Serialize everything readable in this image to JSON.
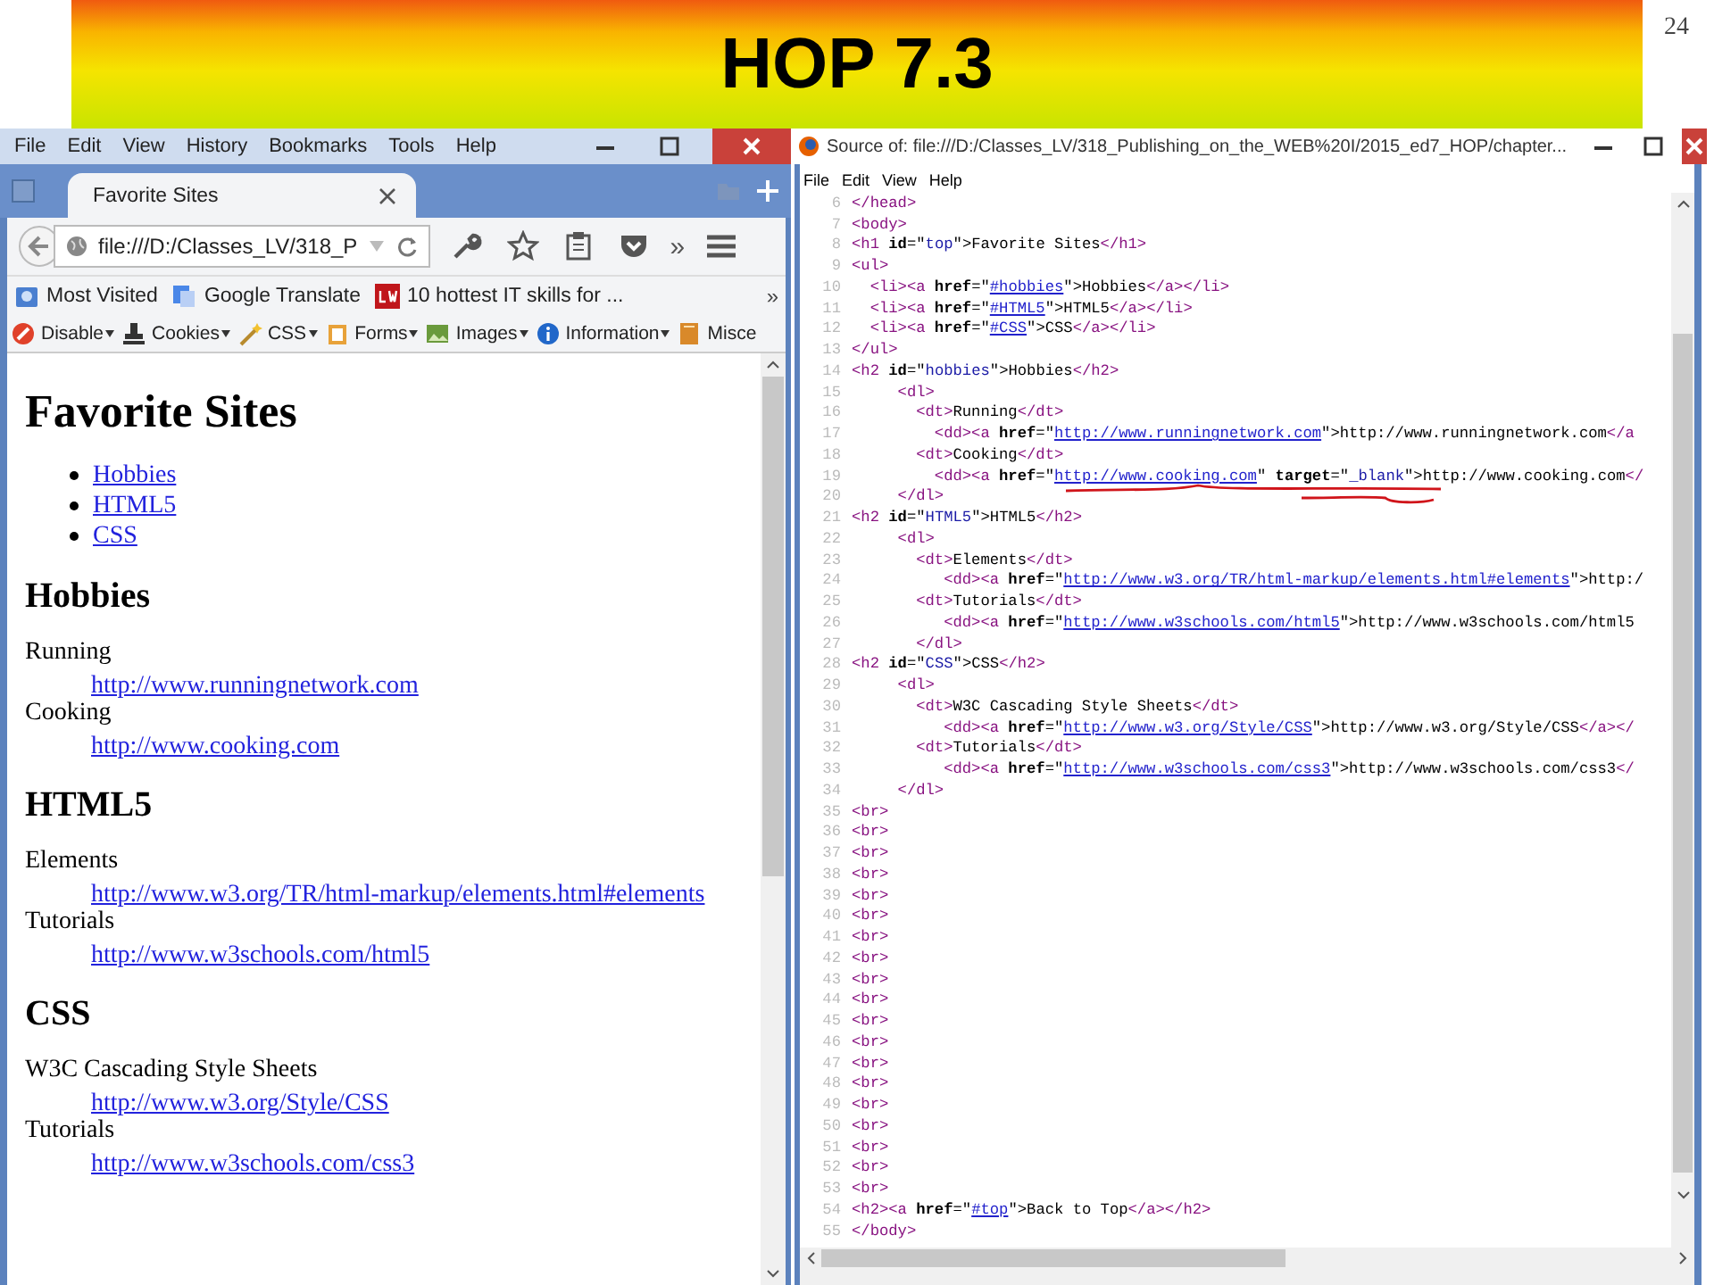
{
  "slide": {
    "title": "HOP 7.3",
    "page_number": "24"
  },
  "browser": {
    "menu": [
      "File",
      "Edit",
      "View",
      "History",
      "Bookmarks",
      "Tools",
      "Help"
    ],
    "tabs": [
      {
        "label": "Favorite Sites",
        "selected": true
      }
    ],
    "address": "file:///D:/Classes_LV/318_P",
    "overflow_chevron": "»",
    "bookmarks": [
      {
        "label": "Most Visited",
        "kind": "folder"
      },
      {
        "label": "Google Translate",
        "kind": "translate"
      },
      {
        "label": "10 hottest IT skills for ...",
        "kind": "cw"
      }
    ],
    "bookmarks_chevron": "»",
    "dev_toolbar": [
      {
        "label": "Disable",
        "kind": "disable"
      },
      {
        "label": "Cookies",
        "kind": "cookies"
      },
      {
        "label": "CSS",
        "kind": "css"
      },
      {
        "label": "Forms",
        "kind": "forms"
      },
      {
        "label": "Images",
        "kind": "images"
      },
      {
        "label": "Information",
        "kind": "info"
      },
      {
        "label": "Misce",
        "kind": "misc"
      }
    ],
    "page": {
      "heading": "Favorite Sites",
      "toc": [
        "Hobbies",
        "HTML5",
        "CSS"
      ],
      "sections": [
        {
          "heading": "Hobbies",
          "entries": [
            {
              "term": "Running",
              "link": "http://www.runningnetwork.com"
            },
            {
              "term": "Cooking",
              "link": "http://www.cooking.com"
            }
          ]
        },
        {
          "heading": "HTML5",
          "entries": [
            {
              "term": "Elements",
              "link": "http://www.w3.org/TR/html-markup/elements.html#elements"
            },
            {
              "term": "Tutorials",
              "link": "http://www.w3schools.com/html5"
            }
          ]
        },
        {
          "heading": "CSS",
          "entries": [
            {
              "term": "W3C Cascading Style Sheets",
              "link": "http://www.w3.org/Style/CSS"
            },
            {
              "term": "Tutorials",
              "link": "http://www.w3schools.com/css3"
            }
          ]
        }
      ]
    }
  },
  "source_window": {
    "title": "Source of: file:///D:/Classes_LV/318_Publishing_on_the_WEB%20I/2015_ed7_HOP/chapter...",
    "menu": [
      "File",
      "Edit",
      "View",
      "Help"
    ],
    "lines": [
      {
        "number": "6",
        "tokens": [
          {
            "kind": "tag",
            "text": "</head>"
          }
        ]
      },
      {
        "number": "7",
        "tokens": [
          {
            "kind": "tag",
            "text": "<body>"
          }
        ]
      },
      {
        "number": "8",
        "tokens": [
          {
            "kind": "tag",
            "text": "<h1"
          },
          {
            "kind": "attr",
            "text": " id"
          },
          {
            "kind": "text",
            "text": "=\""
          },
          {
            "kind": "value",
            "text": "top"
          },
          {
            "kind": "text",
            "text": "\">Favorite Sites"
          },
          {
            "kind": "tag",
            "text": "</h1>"
          }
        ]
      },
      {
        "number": "9",
        "tokens": [
          {
            "kind": "tag",
            "text": "<ul>"
          }
        ]
      },
      {
        "number": "10",
        "tokens": [
          {
            "kind": "tag",
            "text": "  <li><a"
          },
          {
            "kind": "attr",
            "text": " href"
          },
          {
            "kind": "text",
            "text": "=\""
          },
          {
            "kind": "link",
            "text": "#hobbies"
          },
          {
            "kind": "text",
            "text": "\">Hobbies"
          },
          {
            "kind": "tag",
            "text": "</a></li>"
          }
        ]
      },
      {
        "number": "11",
        "tokens": [
          {
            "kind": "tag",
            "text": "  <li><a"
          },
          {
            "kind": "attr",
            "text": " href"
          },
          {
            "kind": "text",
            "text": "=\""
          },
          {
            "kind": "link",
            "text": "#HTML5"
          },
          {
            "kind": "text",
            "text": "\">HTML5"
          },
          {
            "kind": "tag",
            "text": "</a></li>"
          }
        ]
      },
      {
        "number": "12",
        "tokens": [
          {
            "kind": "tag",
            "text": "  <li><a"
          },
          {
            "kind": "attr",
            "text": " href"
          },
          {
            "kind": "text",
            "text": "=\""
          },
          {
            "kind": "link",
            "text": "#CSS"
          },
          {
            "kind": "text",
            "text": "\">CSS"
          },
          {
            "kind": "tag",
            "text": "</a></li>"
          }
        ]
      },
      {
        "number": "13",
        "tokens": [
          {
            "kind": "tag",
            "text": "</ul>"
          }
        ]
      },
      {
        "number": "14",
        "tokens": [
          {
            "kind": "tag",
            "text": "<h2"
          },
          {
            "kind": "attr",
            "text": " id"
          },
          {
            "kind": "text",
            "text": "=\""
          },
          {
            "kind": "value",
            "text": "hobbies"
          },
          {
            "kind": "text",
            "text": "\">Hobbies"
          },
          {
            "kind": "tag",
            "text": "</h2>"
          }
        ]
      },
      {
        "number": "15",
        "tokens": [
          {
            "kind": "tag",
            "text": "     <dl>"
          }
        ]
      },
      {
        "number": "16",
        "tokens": [
          {
            "kind": "tag",
            "text": "       <dt>"
          },
          {
            "kind": "text",
            "text": "Running"
          },
          {
            "kind": "tag",
            "text": "</dt>"
          }
        ]
      },
      {
        "number": "17",
        "tokens": [
          {
            "kind": "tag",
            "text": "         <dd><a"
          },
          {
            "kind": "attr",
            "text": " href"
          },
          {
            "kind": "text",
            "text": "=\""
          },
          {
            "kind": "link",
            "text": "http://www.runningnetwork.com"
          },
          {
            "kind": "text",
            "text": "\">http://www.runningnetwork.com"
          },
          {
            "kind": "tag",
            "text": "</a"
          }
        ]
      },
      {
        "number": "18",
        "tokens": [
          {
            "kind": "tag",
            "text": "       <dt>"
          },
          {
            "kind": "text",
            "text": "Cooking"
          },
          {
            "kind": "tag",
            "text": "</dt>"
          }
        ]
      },
      {
        "number": "19",
        "tokens": [
          {
            "kind": "tag",
            "text": "         <dd><a"
          },
          {
            "kind": "attr",
            "text": " href"
          },
          {
            "kind": "text",
            "text": "=\""
          },
          {
            "kind": "link",
            "text": "http://www.cooking.com"
          },
          {
            "kind": "text",
            "text": "\""
          },
          {
            "kind": "attr",
            "text": " target"
          },
          {
            "kind": "text",
            "text": "=\""
          },
          {
            "kind": "value",
            "text": "_blank"
          },
          {
            "kind": "text",
            "text": "\">http://www.cooking.com"
          },
          {
            "kind": "tag",
            "text": "</"
          }
        ]
      },
      {
        "number": "20",
        "tokens": [
          {
            "kind": "tag",
            "text": "     </dl>"
          }
        ]
      },
      {
        "number": "21",
        "tokens": [
          {
            "kind": "tag",
            "text": "<h2"
          },
          {
            "kind": "attr",
            "text": " id"
          },
          {
            "kind": "text",
            "text": "=\""
          },
          {
            "kind": "value",
            "text": "HTML5"
          },
          {
            "kind": "text",
            "text": "\">HTML5"
          },
          {
            "kind": "tag",
            "text": "</h2>"
          }
        ]
      },
      {
        "number": "22",
        "tokens": [
          {
            "kind": "tag",
            "text": "     <dl>"
          }
        ]
      },
      {
        "number": "23",
        "tokens": [
          {
            "kind": "tag",
            "text": "       <dt>"
          },
          {
            "kind": "text",
            "text": "Elements"
          },
          {
            "kind": "tag",
            "text": "</dt>"
          }
        ]
      },
      {
        "number": "24",
        "tokens": [
          {
            "kind": "tag",
            "text": "          <dd><a"
          },
          {
            "kind": "attr",
            "text": " href"
          },
          {
            "kind": "text",
            "text": "=\""
          },
          {
            "kind": "link",
            "text": "http://www.w3.org/TR/html-markup/elements.html#elements"
          },
          {
            "kind": "text",
            "text": "\">http:/"
          }
        ]
      },
      {
        "number": "25",
        "tokens": [
          {
            "kind": "tag",
            "text": "       <dt>"
          },
          {
            "kind": "text",
            "text": "Tutorials"
          },
          {
            "kind": "tag",
            "text": "</dt>"
          }
        ]
      },
      {
        "number": "26",
        "tokens": [
          {
            "kind": "tag",
            "text": "          <dd><a"
          },
          {
            "kind": "attr",
            "text": " href"
          },
          {
            "kind": "text",
            "text": "=\""
          },
          {
            "kind": "link",
            "text": "http://www.w3schools.com/html5"
          },
          {
            "kind": "text",
            "text": "\">http://www.w3schools.com/html5"
          }
        ]
      },
      {
        "number": "27",
        "tokens": [
          {
            "kind": "tag",
            "text": "       </dl>"
          }
        ]
      },
      {
        "number": "28",
        "tokens": [
          {
            "kind": "tag",
            "text": "<h2"
          },
          {
            "kind": "attr",
            "text": " id"
          },
          {
            "kind": "text",
            "text": "=\""
          },
          {
            "kind": "value",
            "text": "CSS"
          },
          {
            "kind": "text",
            "text": "\">CSS"
          },
          {
            "kind": "tag",
            "text": "</h2>"
          }
        ]
      },
      {
        "number": "29",
        "tokens": [
          {
            "kind": "tag",
            "text": "     <dl>"
          }
        ]
      },
      {
        "number": "30",
        "tokens": [
          {
            "kind": "tag",
            "text": "       <dt>"
          },
          {
            "kind": "text",
            "text": "W3C Cascading Style Sheets"
          },
          {
            "kind": "tag",
            "text": "</dt>"
          }
        ]
      },
      {
        "number": "31",
        "tokens": [
          {
            "kind": "tag",
            "text": "          <dd><a"
          },
          {
            "kind": "attr",
            "text": " href"
          },
          {
            "kind": "text",
            "text": "=\""
          },
          {
            "kind": "link",
            "text": "http://www.w3.org/Style/CSS"
          },
          {
            "kind": "text",
            "text": "\">http://www.w3.org/Style/CSS"
          },
          {
            "kind": "tag",
            "text": "</a></"
          }
        ]
      },
      {
        "number": "32",
        "tokens": [
          {
            "kind": "tag",
            "text": "       <dt>"
          },
          {
            "kind": "text",
            "text": "Tutorials"
          },
          {
            "kind": "tag",
            "text": "</dt>"
          }
        ]
      },
      {
        "number": "33",
        "tokens": [
          {
            "kind": "tag",
            "text": "          <dd><a"
          },
          {
            "kind": "attr",
            "text": " href"
          },
          {
            "kind": "text",
            "text": "=\""
          },
          {
            "kind": "link",
            "text": "http://www.w3schools.com/css3"
          },
          {
            "kind": "text",
            "text": "\">http://www.w3schools.com/css3"
          },
          {
            "kind": "tag",
            "text": "</"
          }
        ]
      },
      {
        "number": "34",
        "tokens": [
          {
            "kind": "tag",
            "text": "     </dl>"
          }
        ]
      },
      {
        "number": "35",
        "tokens": [
          {
            "kind": "tag",
            "text": "<br>"
          }
        ]
      },
      {
        "number": "36",
        "tokens": [
          {
            "kind": "tag",
            "text": "<br>"
          }
        ]
      },
      {
        "number": "37",
        "tokens": [
          {
            "kind": "tag",
            "text": "<br>"
          }
        ]
      },
      {
        "number": "38",
        "tokens": [
          {
            "kind": "tag",
            "text": "<br>"
          }
        ]
      },
      {
        "number": "39",
        "tokens": [
          {
            "kind": "tag",
            "text": "<br>"
          }
        ]
      },
      {
        "number": "40",
        "tokens": [
          {
            "kind": "tag",
            "text": "<br>"
          }
        ]
      },
      {
        "number": "41",
        "tokens": [
          {
            "kind": "tag",
            "text": "<br>"
          }
        ]
      },
      {
        "number": "42",
        "tokens": [
          {
            "kind": "tag",
            "text": "<br>"
          }
        ]
      },
      {
        "number": "43",
        "tokens": [
          {
            "kind": "tag",
            "text": "<br>"
          }
        ]
      },
      {
        "number": "44",
        "tokens": [
          {
            "kind": "tag",
            "text": "<br>"
          }
        ]
      },
      {
        "number": "45",
        "tokens": [
          {
            "kind": "tag",
            "text": "<br>"
          }
        ]
      },
      {
        "number": "46",
        "tokens": [
          {
            "kind": "tag",
            "text": "<br>"
          }
        ]
      },
      {
        "number": "47",
        "tokens": [
          {
            "kind": "tag",
            "text": "<br>"
          }
        ]
      },
      {
        "number": "48",
        "tokens": [
          {
            "kind": "tag",
            "text": "<br>"
          }
        ]
      },
      {
        "number": "49",
        "tokens": [
          {
            "kind": "tag",
            "text": "<br>"
          }
        ]
      },
      {
        "number": "50",
        "tokens": [
          {
            "kind": "tag",
            "text": "<br>"
          }
        ]
      },
      {
        "number": "51",
        "tokens": [
          {
            "kind": "tag",
            "text": "<br>"
          }
        ]
      },
      {
        "number": "52",
        "tokens": [
          {
            "kind": "tag",
            "text": "<br>"
          }
        ]
      },
      {
        "number": "53",
        "tokens": [
          {
            "kind": "tag",
            "text": "<br>"
          }
        ]
      },
      {
        "number": "54",
        "tokens": [
          {
            "kind": "tag",
            "text": "<h2><a"
          },
          {
            "kind": "attr",
            "text": " href"
          },
          {
            "kind": "text",
            "text": "=\""
          },
          {
            "kind": "link",
            "text": "#top"
          },
          {
            "kind": "text",
            "text": "\">Back to Top"
          },
          {
            "kind": "tag",
            "text": "</a></h2>"
          }
        ]
      },
      {
        "number": "55",
        "tokens": [
          {
            "kind": "tag",
            "text": "</body>"
          }
        ]
      }
    ]
  }
}
